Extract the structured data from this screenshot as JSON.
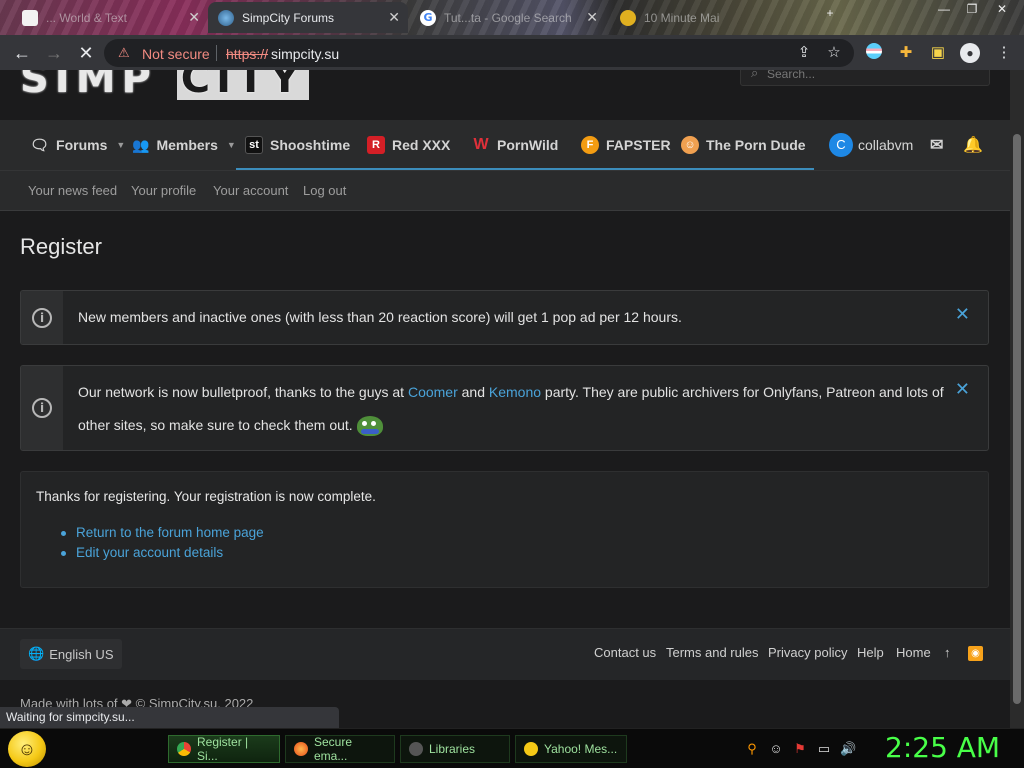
{
  "browser": {
    "tabs": [
      {
        "title": "... World & Text",
        "state": "dim"
      },
      {
        "title": "SimpCity Forums",
        "state": "active"
      },
      {
        "title": "Tut...ta - Google Search",
        "state": "dim"
      },
      {
        "title": "10 Minute Mai",
        "state": "dim"
      }
    ],
    "security_label": "Not secure",
    "url_scheme": "https://",
    "url_host": "simpcity.su"
  },
  "site": {
    "search_placeholder": "Search...",
    "nav": {
      "forums": "Forums",
      "members": "Members",
      "shooshtime": "Shooshtime",
      "redxxx": "Red XXX",
      "pornwild": "PornWild",
      "fapster": "FAPSTER",
      "porndude": "The Porn Dude",
      "username": "collabvm",
      "avatar_letter": "C"
    },
    "subnav": {
      "feed": "Your news feed",
      "profile": "Your profile",
      "account": "Your account",
      "logout": "Log out"
    },
    "page_title": "Register",
    "notice1": "New members and inactive ones (with less than 20 reaction score) will get 1 pop ad per 12 hours.",
    "notice2": {
      "before": "Our network is now bulletproof, thanks to the guys at ",
      "link1": "Coomer",
      "mid": " and ",
      "link2": "Kemono",
      "after": " party. They are public archivers for Onlyfans, Patreon and lots of other sites, so make sure to check them out."
    },
    "registration": {
      "message": "Thanks for registering. Your registration is now complete.",
      "links": [
        "Return to the forum home page",
        "Edit your account details"
      ]
    },
    "footer": {
      "language": "English US",
      "links": [
        "Contact us",
        "Terms and rules",
        "Privacy policy",
        "Help",
        "Home"
      ],
      "copyright": "Made with lots of ❤ © SimpCity.su, 2022"
    },
    "status_text": "Waiting for simpcity.su..."
  },
  "taskbar": {
    "items": [
      {
        "label": "Register | Si...",
        "color": "#4caf50",
        "active": true
      },
      {
        "label": "Secure ema...",
        "color": "#ff7043",
        "active": false
      },
      {
        "label": "Libraries",
        "color": "#555555",
        "active": false
      },
      {
        "label": "Yahoo! Mes...",
        "color": "#f5c916",
        "active": false
      }
    ],
    "clock": "2:25 AM"
  },
  "colors": {
    "accent": "#4aa3d9",
    "nav_underline": "#3c8dbc",
    "clock": "#48ff48"
  }
}
